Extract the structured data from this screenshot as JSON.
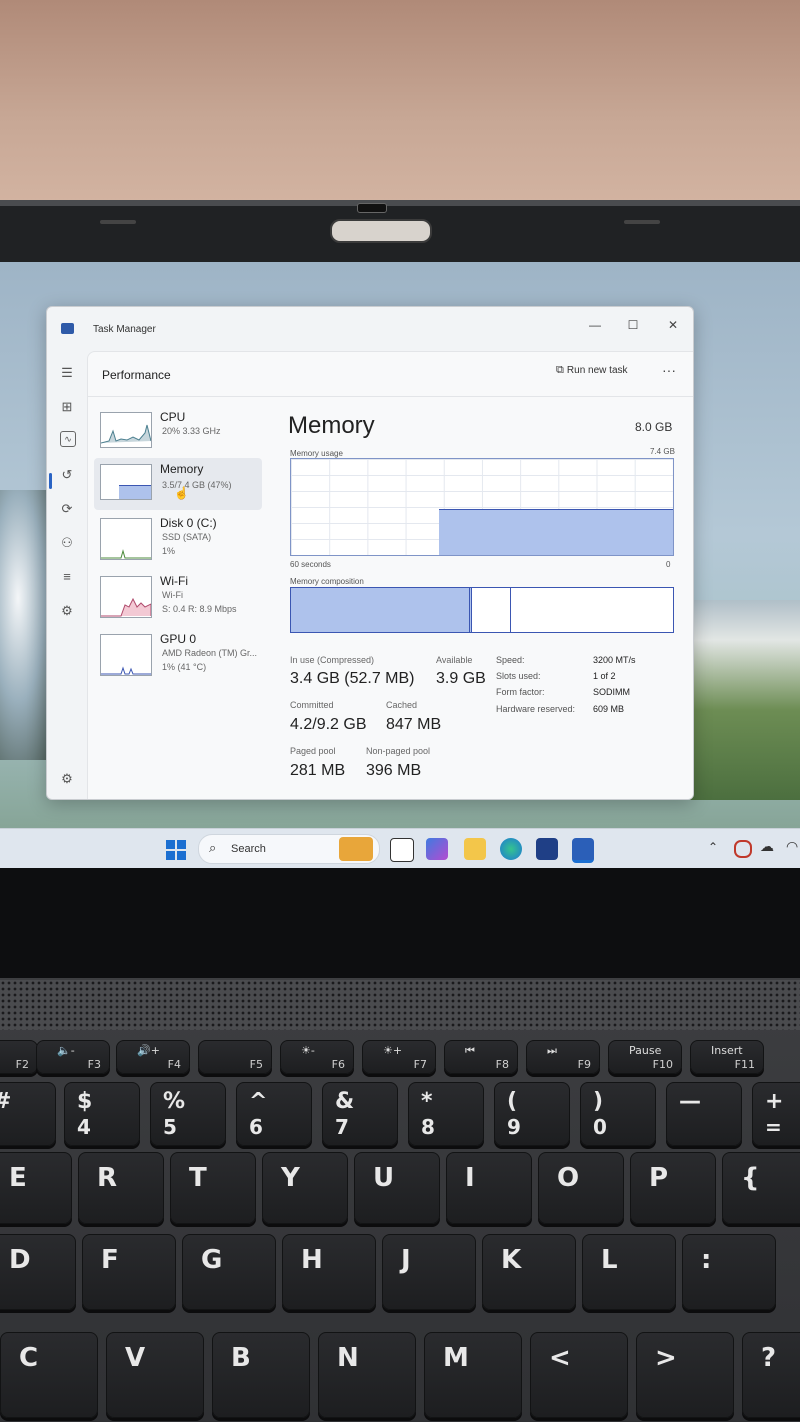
{
  "window": {
    "title": "Task Manager",
    "minimize": "—",
    "maximize": "☐",
    "close": "✕"
  },
  "header": {
    "page_title": "Performance",
    "run_new_task": "Run new task",
    "more": "···"
  },
  "resources": [
    {
      "name": "CPU",
      "line1": "20%  3.33 GHz",
      "line2": ""
    },
    {
      "name": "Memory",
      "line1": "3.5/7.4 GB (47%)",
      "line2": ""
    },
    {
      "name": "Disk 0 (C:)",
      "line1": "SSD (SATA)",
      "line2": "1%"
    },
    {
      "name": "Wi-Fi",
      "line1": "Wi-Fi",
      "line2": "S: 0.4  R: 8.9 Mbps"
    },
    {
      "name": "GPU 0",
      "line1": "AMD Radeon (TM) Gr...",
      "line2": "1%  (41 °C)"
    }
  ],
  "memory": {
    "title": "Memory",
    "total": "8.0 GB",
    "usage_label": "Memory usage",
    "usage_max": "7.4 GB",
    "time_left": "60 seconds",
    "time_right": "0",
    "composition_label": "Memory composition",
    "usage_fraction": 0.47
  },
  "stats": {
    "in_use_label": "In use (Compressed)",
    "in_use": "3.4 GB (52.7 MB)",
    "available_label": "Available",
    "available": "3.9 GB",
    "committed_label": "Committed",
    "committed": "4.2/9.2 GB",
    "cached_label": "Cached",
    "cached": "847 MB",
    "paged_label": "Paged pool",
    "paged": "281 MB",
    "nonpaged_label": "Non-paged pool",
    "nonpaged": "396 MB"
  },
  "specs": [
    {
      "label": "Speed:",
      "value": "3200 MT/s"
    },
    {
      "label": "Slots used:",
      "value": "1 of 2"
    },
    {
      "label": "Form factor:",
      "value": "SODIMM"
    },
    {
      "label": "Hardware reserved:",
      "value": "609 MB"
    }
  ],
  "taskbar": {
    "search_placeholder": "Search"
  },
  "keyboard": {
    "fn_row": [
      {
        "top": "",
        "fn": "F2"
      },
      {
        "top": "🔈-",
        "fn": "F3"
      },
      {
        "top": "🔊+",
        "fn": "F4"
      },
      {
        "top": "",
        "fn": "F5"
      },
      {
        "top": "☀-",
        "fn": "F6"
      },
      {
        "top": "☀+",
        "fn": "F7"
      },
      {
        "top": "⏮",
        "fn": "F8"
      },
      {
        "top": "⏭",
        "fn": "F9"
      },
      {
        "top": "Pause",
        "fn": "F10"
      },
      {
        "top": "Insert",
        "fn": "F11"
      }
    ],
    "num_row": [
      {
        "top": "#",
        "bot": ""
      },
      {
        "top": "$",
        "bot": "4"
      },
      {
        "top": "%",
        "bot": "5"
      },
      {
        "top": "^",
        "bot": "6"
      },
      {
        "top": "&",
        "bot": "7"
      },
      {
        "top": "*",
        "bot": "8"
      },
      {
        "top": "(",
        "bot": "9"
      },
      {
        "top": ")",
        "bot": "0"
      },
      {
        "top": "—",
        "bot": ""
      },
      {
        "top": "+",
        "bot": "="
      }
    ],
    "row_q": [
      "E",
      "R",
      "T",
      "Y",
      "U",
      "I",
      "O",
      "P",
      "{"
    ],
    "row_a": [
      "D",
      "F",
      "G",
      "H",
      "J",
      "K",
      "L",
      ":"
    ],
    "row_z": [
      "C",
      "V",
      "B",
      "N",
      "M",
      "<",
      ">",
      "?"
    ]
  }
}
